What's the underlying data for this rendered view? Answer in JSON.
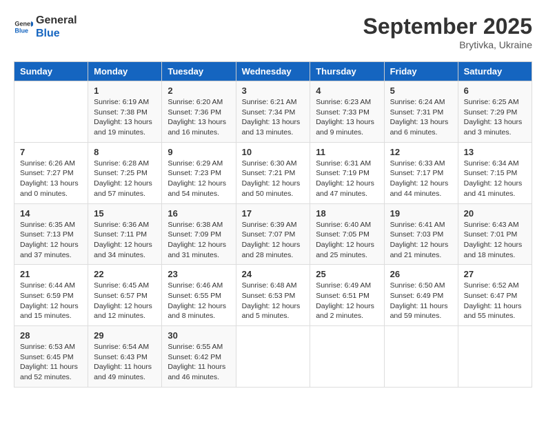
{
  "header": {
    "logo_general": "General",
    "logo_blue": "Blue",
    "month": "September 2025",
    "location": "Brytivka, Ukraine"
  },
  "columns": [
    "Sunday",
    "Monday",
    "Tuesday",
    "Wednesday",
    "Thursday",
    "Friday",
    "Saturday"
  ],
  "weeks": [
    [
      {
        "day": "",
        "info": ""
      },
      {
        "day": "1",
        "info": "Sunrise: 6:19 AM\nSunset: 7:38 PM\nDaylight: 13 hours and 19 minutes."
      },
      {
        "day": "2",
        "info": "Sunrise: 6:20 AM\nSunset: 7:36 PM\nDaylight: 13 hours and 16 minutes."
      },
      {
        "day": "3",
        "info": "Sunrise: 6:21 AM\nSunset: 7:34 PM\nDaylight: 13 hours and 13 minutes."
      },
      {
        "day": "4",
        "info": "Sunrise: 6:23 AM\nSunset: 7:33 PM\nDaylight: 13 hours and 9 minutes."
      },
      {
        "day": "5",
        "info": "Sunrise: 6:24 AM\nSunset: 7:31 PM\nDaylight: 13 hours and 6 minutes."
      },
      {
        "day": "6",
        "info": "Sunrise: 6:25 AM\nSunset: 7:29 PM\nDaylight: 13 hours and 3 minutes."
      }
    ],
    [
      {
        "day": "7",
        "info": "Sunrise: 6:26 AM\nSunset: 7:27 PM\nDaylight: 13 hours and 0 minutes."
      },
      {
        "day": "8",
        "info": "Sunrise: 6:28 AM\nSunset: 7:25 PM\nDaylight: 12 hours and 57 minutes."
      },
      {
        "day": "9",
        "info": "Sunrise: 6:29 AM\nSunset: 7:23 PM\nDaylight: 12 hours and 54 minutes."
      },
      {
        "day": "10",
        "info": "Sunrise: 6:30 AM\nSunset: 7:21 PM\nDaylight: 12 hours and 50 minutes."
      },
      {
        "day": "11",
        "info": "Sunrise: 6:31 AM\nSunset: 7:19 PM\nDaylight: 12 hours and 47 minutes."
      },
      {
        "day": "12",
        "info": "Sunrise: 6:33 AM\nSunset: 7:17 PM\nDaylight: 12 hours and 44 minutes."
      },
      {
        "day": "13",
        "info": "Sunrise: 6:34 AM\nSunset: 7:15 PM\nDaylight: 12 hours and 41 minutes."
      }
    ],
    [
      {
        "day": "14",
        "info": "Sunrise: 6:35 AM\nSunset: 7:13 PM\nDaylight: 12 hours and 37 minutes."
      },
      {
        "day": "15",
        "info": "Sunrise: 6:36 AM\nSunset: 7:11 PM\nDaylight: 12 hours and 34 minutes."
      },
      {
        "day": "16",
        "info": "Sunrise: 6:38 AM\nSunset: 7:09 PM\nDaylight: 12 hours and 31 minutes."
      },
      {
        "day": "17",
        "info": "Sunrise: 6:39 AM\nSunset: 7:07 PM\nDaylight: 12 hours and 28 minutes."
      },
      {
        "day": "18",
        "info": "Sunrise: 6:40 AM\nSunset: 7:05 PM\nDaylight: 12 hours and 25 minutes."
      },
      {
        "day": "19",
        "info": "Sunrise: 6:41 AM\nSunset: 7:03 PM\nDaylight: 12 hours and 21 minutes."
      },
      {
        "day": "20",
        "info": "Sunrise: 6:43 AM\nSunset: 7:01 PM\nDaylight: 12 hours and 18 minutes."
      }
    ],
    [
      {
        "day": "21",
        "info": "Sunrise: 6:44 AM\nSunset: 6:59 PM\nDaylight: 12 hours and 15 minutes."
      },
      {
        "day": "22",
        "info": "Sunrise: 6:45 AM\nSunset: 6:57 PM\nDaylight: 12 hours and 12 minutes."
      },
      {
        "day": "23",
        "info": "Sunrise: 6:46 AM\nSunset: 6:55 PM\nDaylight: 12 hours and 8 minutes."
      },
      {
        "day": "24",
        "info": "Sunrise: 6:48 AM\nSunset: 6:53 PM\nDaylight: 12 hours and 5 minutes."
      },
      {
        "day": "25",
        "info": "Sunrise: 6:49 AM\nSunset: 6:51 PM\nDaylight: 12 hours and 2 minutes."
      },
      {
        "day": "26",
        "info": "Sunrise: 6:50 AM\nSunset: 6:49 PM\nDaylight: 11 hours and 59 minutes."
      },
      {
        "day": "27",
        "info": "Sunrise: 6:52 AM\nSunset: 6:47 PM\nDaylight: 11 hours and 55 minutes."
      }
    ],
    [
      {
        "day": "28",
        "info": "Sunrise: 6:53 AM\nSunset: 6:45 PM\nDaylight: 11 hours and 52 minutes."
      },
      {
        "day": "29",
        "info": "Sunrise: 6:54 AM\nSunset: 6:43 PM\nDaylight: 11 hours and 49 minutes."
      },
      {
        "day": "30",
        "info": "Sunrise: 6:55 AM\nSunset: 6:42 PM\nDaylight: 11 hours and 46 minutes."
      },
      {
        "day": "",
        "info": ""
      },
      {
        "day": "",
        "info": ""
      },
      {
        "day": "",
        "info": ""
      },
      {
        "day": "",
        "info": ""
      }
    ]
  ]
}
